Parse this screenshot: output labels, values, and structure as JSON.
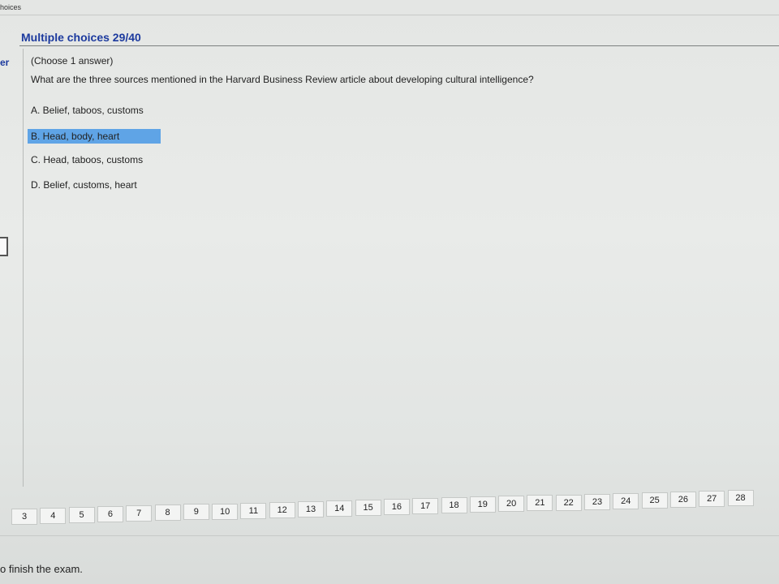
{
  "tab": {
    "label": "hoices"
  },
  "header": {
    "title": "Multiple choices 29/40"
  },
  "left_fragment": "er",
  "question": {
    "instruction": "(Choose 1 answer)",
    "text": "What are the three sources mentioned in the Harvard Business Review article about developing cultural intelligence?",
    "options": [
      {
        "label": "A. Belief, taboos, customs",
        "selected": false
      },
      {
        "label": "B. Head, body, heart",
        "selected": true
      },
      {
        "label": "C. Head, taboos, customs",
        "selected": false
      },
      {
        "label": "D. Belief, customs, heart",
        "selected": false
      }
    ]
  },
  "pager": {
    "pages": [
      "3",
      "4",
      "5",
      "6",
      "7",
      "8",
      "9",
      "10",
      "11",
      "12",
      "13",
      "14",
      "15",
      "16",
      "17",
      "18",
      "19",
      "20",
      "21",
      "22",
      "23",
      "24",
      "25",
      "26",
      "27",
      "28"
    ]
  },
  "footer": {
    "text": "o finish the exam."
  },
  "colors": {
    "title": "#1c3a9e",
    "selection": "#5fa4e6"
  }
}
